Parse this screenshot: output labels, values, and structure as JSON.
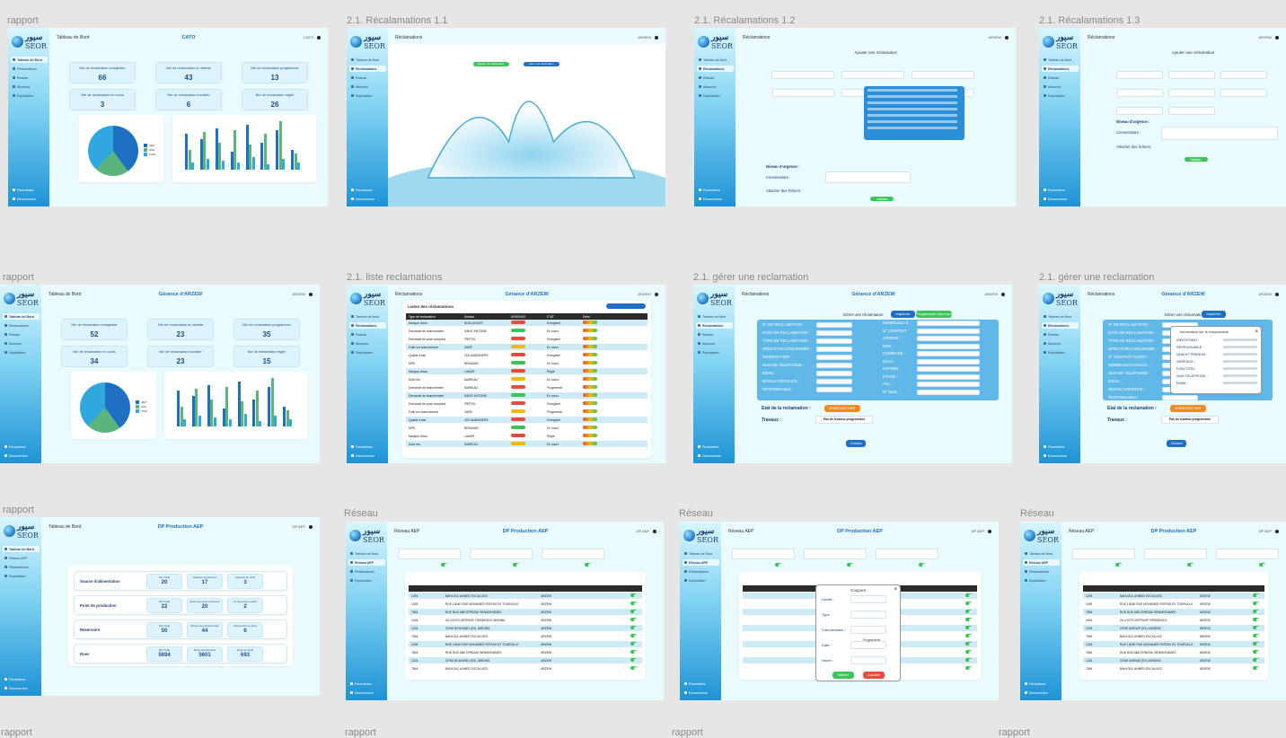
{
  "frames": [
    {
      "label": "rapport",
      "type": "dashboard",
      "title": "Tableau de Bord",
      "center": "CATO",
      "user": "CATO",
      "nav": [
        "Tableau de Bord",
        "Réclamations",
        "Réseau",
        "Abonnés",
        "Exploitation"
      ],
      "active": 0,
      "stats": [
        {
          "label": "Nbr de réclamation enregistrer",
          "value": "66"
        },
        {
          "label": "Nbr de réclamation en attente",
          "value": "43"
        },
        {
          "label": "Nbr de réclamation programmer",
          "value": "13"
        },
        {
          "label": "Nbr de réclamation en cours",
          "value": "3"
        },
        {
          "label": "Nbr de réclamation travailler",
          "value": "6"
        },
        {
          "label": "Nbr de réclamation régler",
          "value": "26"
        }
      ],
      "legend": [
        "AEP",
        "ASS",
        "COM"
      ]
    },
    {
      "label": "2.1. Récalamations 1.1",
      "type": "splash",
      "title": "Réclamations",
      "user": "ARZEW",
      "nav": [
        "Tableau de Bord",
        "Réclamations",
        "Réseau",
        "Abonnés",
        "Exploitation"
      ],
      "active": 1,
      "buttons": [
        "Ajouter une réclamation",
        "Gérer une réclamation"
      ]
    },
    {
      "label": "2.1. Récalamations 1.2",
      "type": "form",
      "title": "Réclamations",
      "user": "ARZEW",
      "nav": [
        "Tableau de Bord",
        "Réclamations",
        "Réseau",
        "Abonnés",
        "Exploitation"
      ],
      "active": 1,
      "heading": "Ajouter une réclamation",
      "attach": "Attacher des fichiers:",
      "urgency": "Niveau d'urgence :",
      "comment": "Commentaire :",
      "submit": "Valider"
    },
    {
      "label": "2.1. Récalamations 1.3",
      "type": "form2",
      "title": "Réclamations",
      "user": "ARZEW",
      "nav": [
        "Tableau de Bord",
        "Réclamations",
        "Réseau",
        "Abonnés",
        "Exploitation"
      ],
      "active": 1,
      "heading": "Ajouter une réclamation",
      "attach": "Attacher des fichiers:",
      "urgency": "Niveau d'urgence :",
      "comment": "Commentaire :",
      "submit": "Valider"
    },
    {
      "label": "rapport",
      "type": "dashboard",
      "title": "Tableau de Bord",
      "center": "Gérance d'ARZEW",
      "user": "ARZEW",
      "nav": [
        "Tableau de Bord",
        "Réclamations",
        "Réseau",
        "Abonnés",
        "Exploitation"
      ],
      "active": 0,
      "stats": [
        {
          "label": "Nbr de réclamation enregistrer",
          "value": "52"
        },
        {
          "label": "Nbr de réclamation en attente",
          "value": "23"
        },
        {
          "label": "Nbr de réclamation programmer",
          "value": "35"
        },
        {
          "label": "Nbr de réclamation en cours",
          "value": "34"
        },
        {
          "label": "Nbr de réclamation travailler",
          "value": "23"
        },
        {
          "label": "Nbr de réclamation régler",
          "value": "15"
        }
      ],
      "legend": [
        "AEP",
        "ASS",
        "COM"
      ]
    },
    {
      "label": "2.1. liste reclamations",
      "type": "list",
      "title": "Réclamations",
      "center": "Gérance d'ARZEW",
      "user": "ARZEW",
      "nav": [
        "Tableau de Bord",
        "Réclamations",
        "Réseau",
        "Abonnés",
        "Exploitation"
      ],
      "active": 1,
      "heading": "Listes des réclamations",
      "cols": [
        "Type de réclamation",
        "Secteur",
        "URGENCE",
        "ÉTAT",
        "Délai"
      ],
      "rows": [
        [
          "Manque d'eau",
          "BOULANGER",
          "Enregistré"
        ],
        [
          "Demande de branchement",
          "SAINT ANTOINE",
          "En cours"
        ],
        [
          "Demande de pose compteur",
          "FRETIN",
          "Enregistré"
        ],
        [
          "Fuite sur branchement",
          "ZARE",
          "En cours"
        ],
        [
          "Qualité d'eau",
          "LES AMANDIERS",
          "Enregistré"
        ],
        [
          "MPE",
          "BENAKAR",
          "En cours"
        ],
        [
          "Manque d'eau",
          "LAMUR",
          "Réglé"
        ],
        [
          "Suivi rés.",
          "MARIKALI",
          "En cours"
        ],
        [
          "Demande de branchement",
          "MARIKALI",
          "Programmé"
        ],
        [
          "Demande de branchement",
          "SAINT ANTOINE",
          "En cours"
        ],
        [
          "Demande de pose compteur",
          "FRETIN",
          "Enregistré"
        ],
        [
          "Fuite sur branchement",
          "ZARE",
          "Programmé"
        ],
        [
          "Qualité d'eau",
          "LES AMANDIERS",
          "Enregistré"
        ],
        [
          "MPE",
          "BENAKAR",
          "En cours"
        ],
        [
          "Manque d'eau",
          "LAMUR",
          "Réglé"
        ],
        [
          "Suivi rés.",
          "MARIKALI",
          "En cours"
        ]
      ]
    },
    {
      "label": "2.1. gérer une reclamation",
      "type": "manage",
      "title": "Réclamations",
      "center": "Gérance d'ARZEW",
      "user": "ARZEW",
      "nav": [
        "Tableau de Bord",
        "Réclamations",
        "Réseau",
        "Abonnés",
        "Exploitation"
      ],
      "active": 1,
      "heading": "Gérer une réclamation",
      "print": "Imprimer",
      "program": "Programmer des travaux",
      "fieldsL": [
        "N° DE RECLAMATION :",
        "DATE DE RECLAMATION :",
        "TYPE DE RECLAMATION :",
        "DIRECTION CONCERNÉE :",
        "OBSERVATION :",
        "NUM DE TELEPHONE :",
        "EMAIL :",
        "NIVEAU URGENCE :",
        "RESPONSABLE :"
      ],
      "fieldsR": [
        "NOM/Raison S. :",
        "N° CONTRAT :",
        "ADRESS :",
        "RUE :",
        "COMMUNE :",
        "BLOC :",
        "ENTRÉE :",
        "ETAGE :",
        "ASL :",
        "N° DEM :"
      ],
      "etat": "Etat de la reclamation :",
      "etat_val": "ENREGISTRER",
      "travaux": "Travaux :",
      "travaux_val": "Pas de travaux programmer",
      "close": "Cloturé"
    },
    {
      "label": "2.1. gérer une reclamation",
      "type": "manage2",
      "title": "Réclamations",
      "center": "Gérance d'ARZEW",
      "user": "ARZEW",
      "nav": [
        "Tableau de Bord",
        "Réclamations",
        "Réseau",
        "Abonnés",
        "Exploitation"
      ],
      "active": 1,
      "heading": "Gérer une réclamation",
      "print": "Imprimer",
      "fieldsL": [
        "N° DE RECLAMATION :",
        "DATE DE RECLAMATION :",
        "TYPE DE RECLAMATION :",
        "DIRECTION CONCERNÉE :",
        "N° CONTRAT CLIENT :",
        "NOM/RAISON SOCIAL :",
        "NUM DE TELEPHONE :",
        "EMAIL :",
        "NIVEAU URGENCE :",
        "RESPONSABLE :"
      ],
      "popup_title": "Information sur le responsable",
      "popup_fields": [
        "IDENTIFIANT :",
        "RESPONSABLE :",
        "NOM ET PRENOM :",
        "GERENCE :",
        "FONCTION :",
        "NUM TELEPHONE :",
        "EMAIL :"
      ],
      "etat": "Etat de la reclamation :",
      "etat_val": "ENREGISTRER",
      "travaux": "Travaux :",
      "travaux_val": "Pas de travaux programmer",
      "close": "Cloturé"
    },
    {
      "label": "rapport",
      "type": "report",
      "title": "Tableau de Bord",
      "center": "DP Production AEP",
      "user": "DP AEP",
      "nav": [
        "Tableau de Bord",
        "Réseau AEP",
        "Réclamations",
        "Exploitation"
      ],
      "active": 0,
      "rows": [
        {
          "name": "Source d'alimentation",
          "cells": [
            [
              "Nbr Total",
              "20"
            ],
            [
              "capacite fonctionnel",
              "17"
            ],
            [
              "capacité en arrêt",
              "3"
            ]
          ]
        },
        {
          "name": "Point de production",
          "cells": [
            [
              "Nbr Total",
              "22"
            ],
            [
              "Point de prod fonctionnel",
              "20"
            ],
            [
              "Pt de prod en arrêt",
              "2"
            ]
          ]
        },
        {
          "name": "Réservoire",
          "cells": [
            [
              "Nbr Total",
              "50"
            ],
            [
              "Réservoirs fonctionnels",
              "44"
            ],
            [
              "Réservoirs en arrêt",
              "6"
            ]
          ]
        },
        {
          "name": "Rues",
          "cells": [
            [
              "Nbr Total",
              "5694"
            ],
            [
              "Rues fonctionnels",
              "5601"
            ],
            [
              "Rues en arrêt",
              "693"
            ]
          ]
        }
      ]
    },
    {
      "label": "Réseau",
      "type": "network",
      "title": "Réseau AEP",
      "center": "DP Production AEP",
      "user": "DP AEP",
      "nav": [
        "Tableau de Bord",
        "Réseau AEP",
        "Réclamations",
        "Exploitation"
      ],
      "active": 1,
      "rows": [
        [
          "1294",
          "BAHLOUL AHMED EXCALLIED",
          "ARZEW"
        ],
        [
          "2435",
          "RUE 1304E RUE MOHAMED FERTAS EX TOURVILLE",
          "ARZEW"
        ],
        [
          "7654",
          "RUE RUE ABD ERRIZAK BENMOHAMED",
          "ARZEW"
        ],
        [
          "4434",
          "26 LOGTS DEFRAGF RESIDENCE MARINA",
          "ARZEW"
        ],
        [
          "1234",
          "CENE BOUHANG (EX) JARDINS",
          "ARZEW"
        ],
        [
          "7654",
          "BAHLOUL AHMED EXCALLIED",
          "ARZEW"
        ],
        [
          "2435",
          "RUE 1304E RUE MOHAMED FERTAS EX TOURVILLE",
          "ARZEW"
        ],
        [
          "7654",
          "RUE RUE ABD ERRIZAK BENMOHAMED",
          "ARZEW"
        ],
        [
          "1234",
          "CENE BOUHANG (EX) JARDINS",
          "ARZEW"
        ],
        [
          "7654",
          "BAHLOUL AHMED EXCALLIED",
          "ARZEW"
        ]
      ]
    },
    {
      "label": "Réseau",
      "type": "network-popup",
      "title": "Réseau AEP",
      "center": "DP Production AEP",
      "user": "DP AEP",
      "nav": [
        "Tableau de Bord",
        "Réseau AEP",
        "Réclamations",
        "Exploitation"
      ],
      "active": 1,
      "popup": {
        "title": "Coupure",
        "fields": [
          "Libellé :",
          "Type :",
          "Commentaire :",
          "Date :",
          "Heure :"
        ],
        "option": "Programmer",
        "ok": "Valider",
        "cancel": "Annuler"
      }
    },
    {
      "label": "Réseau",
      "type": "network",
      "title": "Réseau AEP",
      "center": "DP Production AEP",
      "user": "DP AEP",
      "nav": [
        "Tableau de Bord",
        "Réseau AEP",
        "Réclamations",
        "Exploitation"
      ],
      "active": 1,
      "rows": [
        [
          "1294",
          "BAHLOUL AHMED EXCALLIED",
          "ARZEW"
        ],
        [
          "2435",
          "RUE 1304E RUE MOHAMED FERTAS EX TOURVILLE",
          "ARZEW"
        ],
        [
          "7654",
          "RUE RUE ABD ERRIZAK BENMOHAMED",
          "ARZEW"
        ],
        [
          "4434",
          "26 LOGTS DEFRAGF RESIDENCE",
          "ARZEW"
        ],
        [
          "1234",
          "CENE AVENUE (EX) JARDINS",
          "ARZEW"
        ],
        [
          "7654",
          "BAHLOUL AHMED EXCALLIED",
          "ARZEW"
        ],
        [
          "2435",
          "RUE 1304E RUE MOHAMED FERTAS EX TOURVILLE",
          "ARZEW"
        ],
        [
          "7654",
          "RUE RUE ABD ERRIZAK BENMOHAMED",
          "ARZEW"
        ],
        [
          "1234",
          "CENE AVENUE (EX) JARDINS",
          "ARZEW"
        ],
        [
          "7654",
          "BAHLOUL AHMED EXCALLIED",
          "ARZEW"
        ]
      ]
    }
  ],
  "bottom_labels": [
    "rapport",
    "rapport",
    "rapport",
    "rapport"
  ],
  "logo": {
    "ar": "سيور",
    "lat": "SEOR"
  },
  "bottom_nav": [
    "Paramètres",
    "Déconnexion"
  ],
  "colors": {
    "accent": "#1f6fc3",
    "bar_blue": "#1f6fc3",
    "bar_teal": "#2ab3a0",
    "bar_green": "#5cb85c",
    "red": "#e74c3c",
    "green": "#3cc45b"
  }
}
